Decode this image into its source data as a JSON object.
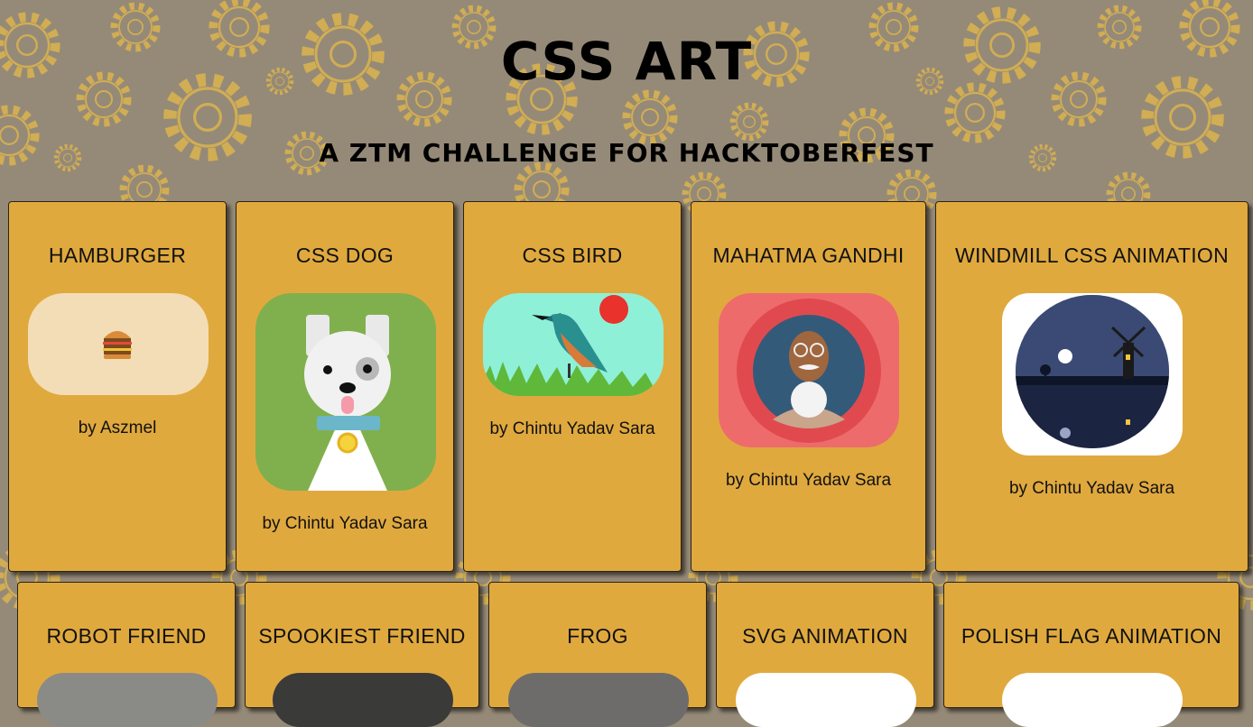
{
  "header": {
    "title": "CSS ART",
    "subtitle": "A ZTM CHALLENGE FOR HACKTOBERFEST"
  },
  "colors": {
    "background": "#958a78",
    "gear": "#d9b150",
    "card": "#e0a93e",
    "text": "#111111"
  },
  "cards": [
    {
      "title": "HAMBURGER",
      "author": "by Aszmel",
      "thumbnail": "hamburger-preview"
    },
    {
      "title": "CSS DOG",
      "author": "by Chintu Yadav Sara",
      "thumbnail": "dog-preview"
    },
    {
      "title": "CSS BIRD",
      "author": "by Chintu Yadav Sara",
      "thumbnail": "bird-preview"
    },
    {
      "title": "MAHATMA GANDHI",
      "author": "by Chintu Yadav Sara",
      "thumbnail": "gandhi-preview"
    },
    {
      "title": "WINDMILL CSS ANIMATION",
      "author": "by Chintu Yadav Sara",
      "thumbnail": "windmill-preview"
    },
    {
      "title": "ROBOT FRIEND",
      "thumbnail": "robot-preview"
    },
    {
      "title": "SPOOKIEST FRIEND",
      "thumbnail": "spooky-preview"
    },
    {
      "title": "FROG",
      "thumbnail": "frog-preview"
    },
    {
      "title": "SVG ANIMATION",
      "thumbnail": "svg-animation-preview"
    },
    {
      "title": "POLISH FLAG ANIMATION",
      "thumbnail": "polish-flag-preview"
    }
  ]
}
